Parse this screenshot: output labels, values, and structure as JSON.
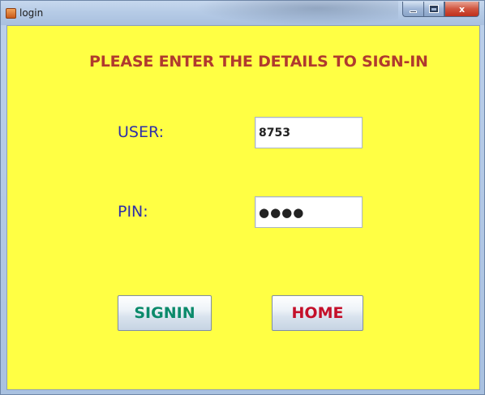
{
  "window": {
    "title": "login",
    "caption_buttons": [
      "minimize",
      "maximize",
      "close"
    ],
    "close_glyph": "x"
  },
  "form": {
    "heading": "PLEASE ENTER THE DETAILS TO SIGN-IN",
    "user_label": "USER:",
    "user_value": "8753",
    "pin_label": "PIN:",
    "pin_value": "●●●●"
  },
  "buttons": {
    "signin": "SIGNIN",
    "home": "HOME"
  },
  "colors": {
    "panel_background": "#ffff44",
    "heading": "#b03a2e",
    "labels": "#2f2fa8",
    "signin_text": "#0b8a6b",
    "home_text": "#c4102a"
  }
}
